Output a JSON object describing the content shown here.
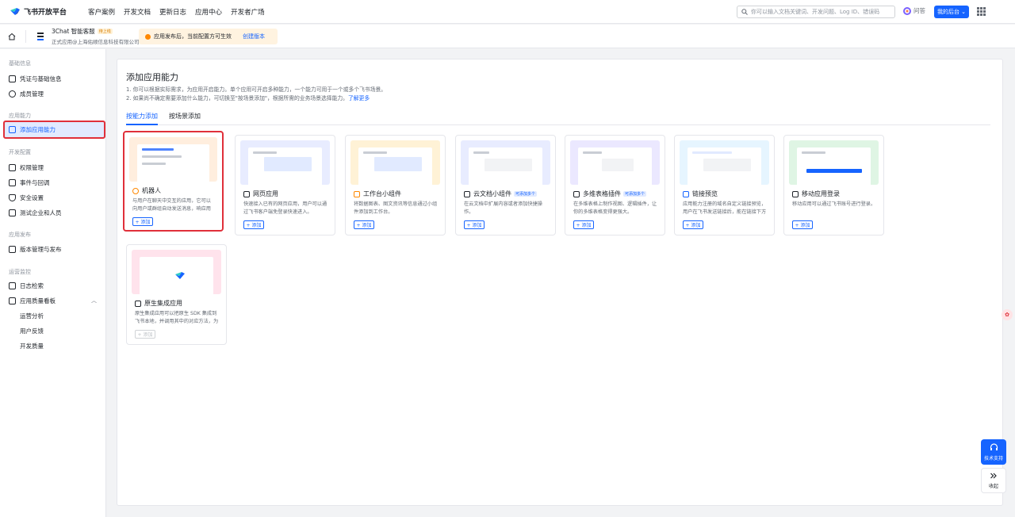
{
  "topnav": {
    "logo_text": "飞书开放平台",
    "items": [
      "客户案例",
      "开发文档",
      "更新日志",
      "应用中心",
      "开发者广场"
    ],
    "search_placeholder": "你可以输入文档关键词、开发问题、Log ID、错误码",
    "ask_label": "问答",
    "backend_label": "我的后台 ⌄"
  },
  "appbar": {
    "app_name": "3Chat 智能客服",
    "app_status": "待上线",
    "app_sub": "正式应用@上海佑顺信息科技有限公司",
    "notice_text": "应用发布后，当前配置方可生效",
    "notice_link": "创建版本"
  },
  "sidebar": {
    "groups": [
      "基础信息",
      "应用能力",
      "开发配置",
      "应用发布",
      "运营监控"
    ],
    "items": [
      "凭证与基础信息",
      "成员管理",
      "添加应用能力",
      "权限管理",
      "事件与回调",
      "安全设置",
      "测试企业和人员",
      "版本管理与发布",
      "日志检索",
      "应用质量看板",
      "运营分析",
      "用户反馈",
      "开发质量"
    ]
  },
  "main": {
    "title": "添加应用能力",
    "desc1": "1. 你可以根据实际需求，为应用开启能力。单个应用可开启多种能力，一个能力可用于一个或多个飞书场景。",
    "desc2": "2. 如果尚不确定需要添加什么能力，可切换至\"按场景添加\"，根据所需的业务场景选择能力。",
    "desc2_link": "了解更多",
    "tabs": [
      "按能力添加",
      "按场景添加"
    ]
  },
  "cards": [
    {
      "title": "机器人",
      "badge": "",
      "desc": "与用户在聊天中交互的应用，它可以向用户或群组自动发送消息，响应用户的消...",
      "add": "+ 添加"
    },
    {
      "title": "网页应用",
      "badge": "",
      "desc": "快速接入已有的网页应用，用户可以通过飞书客户端免登录快速进入。",
      "add": "+ 添加"
    },
    {
      "title": "工作台小组件",
      "badge": "",
      "desc": "将数据图表、图文资讯等信息通过小组件添加到工作台。",
      "add": "+ 添加"
    },
    {
      "title": "云文档小组件",
      "badge": "可添加多个",
      "desc": "在云文档中扩展内容或者添加快捷操作。",
      "add": "+ 添加"
    },
    {
      "title": "多维表格插件",
      "badge": "可添加多个",
      "desc": "在多维表格上制作视图、逻辑插件，让你的多维表格变得更强大。",
      "add": "+ 添加"
    },
    {
      "title": "链接预览",
      "badge": "",
      "desc": "应用能力注册的域名自定义链接预览，用户在飞书发送链接后，能在链接下方展示...",
      "add": "+ 添加"
    },
    {
      "title": "移动应用登录",
      "badge": "",
      "desc": "移动应用可以通过飞书账号进行登录。",
      "add": "+ 添加"
    },
    {
      "title": "原生集成应用",
      "badge": "",
      "desc": "原生集成应用可以把原生 SDK 集成到飞书本地，并调用其中的对应方法，为用户提...",
      "add": "+ 添加"
    }
  ],
  "floating": {
    "support_label": "技术支持",
    "collapse_label": "收起"
  },
  "colors": {
    "accent": "#1664ff",
    "highlight_border": "#e0303a"
  }
}
